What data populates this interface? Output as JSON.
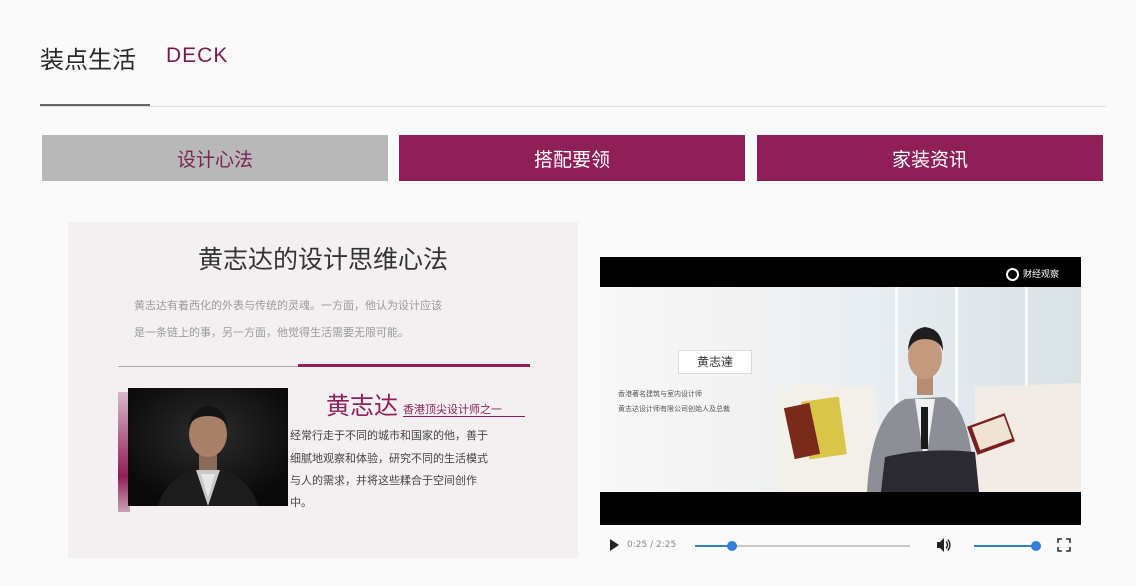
{
  "header": {
    "title": "装点生活",
    "subtitle": "DECK"
  },
  "tabs": [
    {
      "label": "设计心法",
      "active": true
    },
    {
      "label": "搭配要领",
      "active": false
    },
    {
      "label": "家装资讯",
      "active": false
    }
  ],
  "article": {
    "title": "黄志达的设计思维心法",
    "intro_lines": [
      "黄志达有着西化的外表与传统的灵魂。一方面，他认为设计应该",
      "是一条链上的事，另一方面，他觉得生活需要无限可能。"
    ],
    "person_name": "黄志达",
    "person_role": "香港顶尖设计师之一",
    "bio_lines": [
      "经常行走于不同的城市和国家的他，善于",
      "细腻地观察和体验，研究不同的生活模式",
      "与人的需求，并将这些糅合于空间创作",
      "中。"
    ]
  },
  "video": {
    "logo_text": "财经观察",
    "caption_name": "黄志達",
    "caption_lines": [
      "香港著名建筑与室内设计师",
      "黄志达设计师有限公司创始人及总裁"
    ],
    "time": "0:25 / 2:25",
    "progress": 0.17,
    "volume": 1.0
  },
  "colors": {
    "accent": "#8f1f57",
    "tab_active_bg": "#b8b8b8",
    "player_accent": "#2f7fd8"
  },
  "icons": [
    "play-icon",
    "volume-icon",
    "fullscreen-icon"
  ]
}
